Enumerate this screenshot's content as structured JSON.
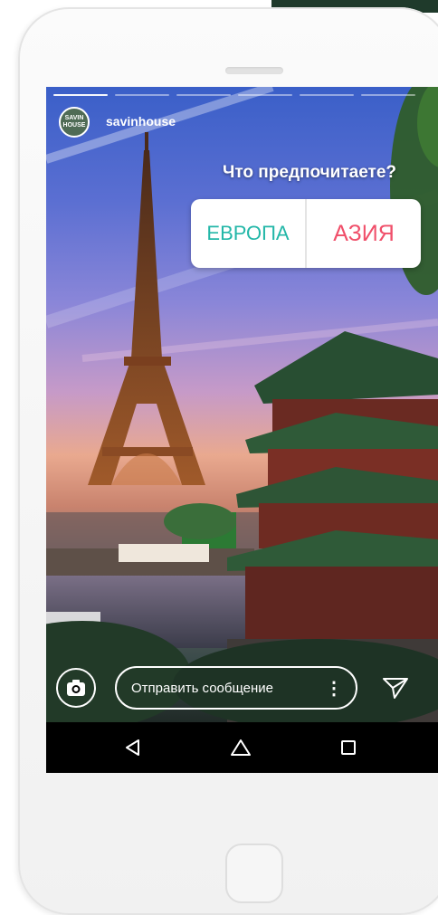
{
  "story": {
    "username": "savinhouse",
    "avatar_text": [
      "SAVIN",
      "HOUSE"
    ],
    "progress_segments": 6,
    "active_segment": 0,
    "poll": {
      "question": "Что предпочитаете?",
      "options": [
        "ЕВРОПА",
        "АЗИЯ"
      ]
    }
  },
  "reply_bar": {
    "camera_icon": "camera-icon",
    "placeholder": "Отправить сообщение",
    "more_icon": "more-vertical-icon",
    "send_icon": "send-icon"
  },
  "system_nav": {
    "back_icon": "back-triangle-icon",
    "home_icon": "home-icon",
    "recents_icon": "recents-square-icon"
  },
  "colors": {
    "poll_left": "#23b7a8",
    "poll_right": "#f04f6a",
    "phone_body": "#f3f3f3"
  }
}
